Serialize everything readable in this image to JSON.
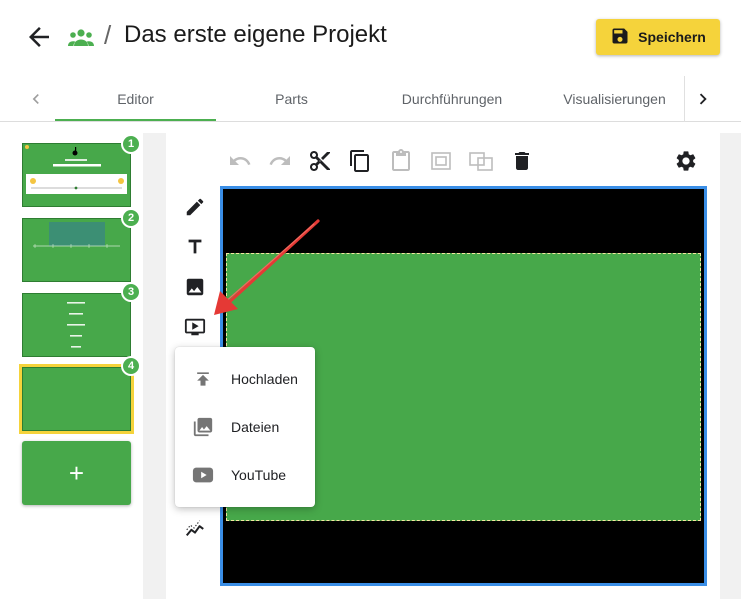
{
  "header": {
    "title": "Das erste eigene Projekt",
    "separator": "/",
    "save_label": "Speichern",
    "accent_color": "#4caf50",
    "save_color": "#f5d33b"
  },
  "tabs": {
    "items": [
      {
        "label": "Editor",
        "active": true
      },
      {
        "label": "Parts",
        "active": false
      },
      {
        "label": "Durchführungen",
        "active": false
      },
      {
        "label": "Visualisierungen",
        "active": false
      }
    ]
  },
  "slides": [
    {
      "number": "1",
      "selected": false
    },
    {
      "number": "2",
      "selected": false
    },
    {
      "number": "3",
      "selected": false
    },
    {
      "number": "4",
      "selected": true
    }
  ],
  "add_slide_label": "+",
  "toolbar": {
    "icons": [
      "undo-icon",
      "redo-icon",
      "cut-icon",
      "copy-icon",
      "paste-icon",
      "group-icon",
      "ungroup-icon",
      "delete-icon",
      "settings-icon"
    ]
  },
  "tools": [
    "pencil-icon",
    "text-icon",
    "image-icon",
    "video-icon",
    "chart-icon"
  ],
  "media_menu": {
    "items": [
      {
        "label": "Hochladen",
        "icon": "upload-icon"
      },
      {
        "label": "Dateien",
        "icon": "photo-library-icon"
      },
      {
        "label": "YouTube",
        "icon": "youtube-icon"
      }
    ]
  }
}
